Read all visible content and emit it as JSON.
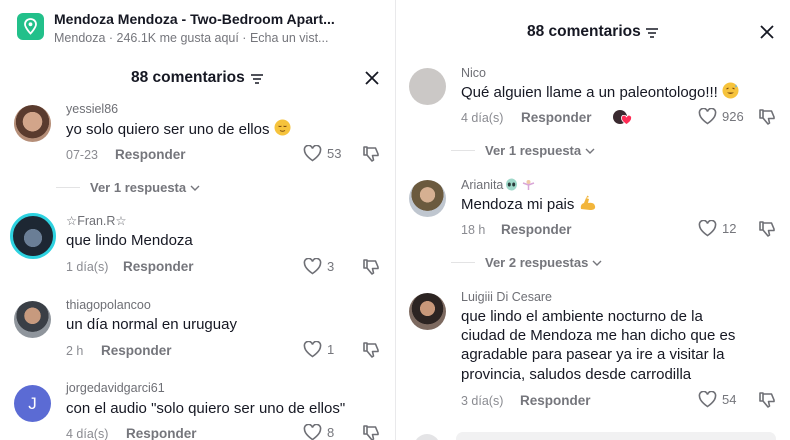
{
  "place": {
    "title": "Mendoza Mendoza - Two-Bedroom Apart...",
    "subtitle": "Mendoza · 246.1K me gusta aquí · Echa un vist..."
  },
  "left_sheet": {
    "title": "88 comentarios",
    "comments": [
      {
        "username": "yessiel86",
        "text": "yo solo quiero ser uno de ellos",
        "emoji": "😌",
        "date": "07-23",
        "reply": "Responder",
        "likes": "53",
        "view_replies": "Ver 1 respuesta"
      },
      {
        "username": "☆Fran.R☆",
        "text": "que lindo Mendoza",
        "date": "1 día(s)",
        "reply": "Responder",
        "likes": "3"
      },
      {
        "username": "thiagopolancoo",
        "text": "un día normal en uruguay",
        "date": "2 h",
        "reply": "Responder",
        "likes": "1"
      },
      {
        "username": "jorgedavidgarci61",
        "avatar_letter": "J",
        "text": "con el audio \"solo quiero ser uno de ellos\"",
        "date": "4 día(s)",
        "reply": "Responder",
        "likes": "8"
      }
    ]
  },
  "right_sheet": {
    "title": "88 comentarios",
    "comments": [
      {
        "username": "Nico",
        "text": "Qué alguien llame a un paleontologo!!!",
        "emoji": "😅",
        "date": "4 día(s)",
        "reply": "Responder",
        "likes": "926",
        "view_replies": "Ver 1 respuesta"
      },
      {
        "username": "Arianita",
        "text": "Mendoza mi pais",
        "emoji": "💪",
        "date": "18 h",
        "reply": "Responder",
        "likes": "12",
        "view_replies": "Ver 2 respuestas"
      },
      {
        "username": "Luigiii Di Cesare",
        "text_lines": [
          "que lindo el ambiente nocturno de la",
          "ciudad de Mendoza me han dicho que es",
          "agradable para pasear ya ire a visitar la",
          "provincia, saludos desde carrodilla"
        ],
        "date": "3 día(s)",
        "reply": "Responder",
        "likes": "54"
      }
    ]
  },
  "colors": {
    "place_icon": "#22c08a",
    "avatar_letter_bg": "#5b6bd4",
    "creator_liked_red": "#fe2c55"
  }
}
